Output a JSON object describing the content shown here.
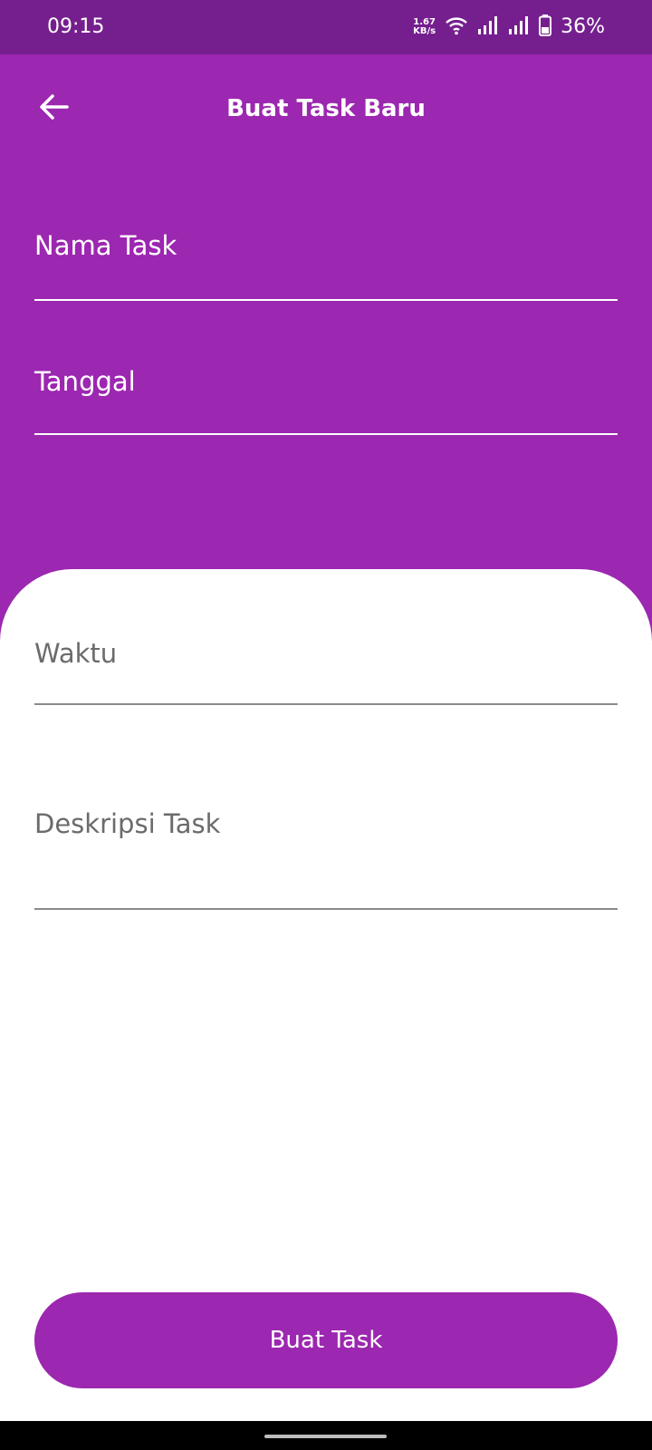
{
  "status_bar": {
    "time": "09:15",
    "net_speed_value": "1.67",
    "net_speed_unit": "KB/s",
    "battery_percent": "36%",
    "icons": [
      "wifi-icon",
      "signal-icon",
      "signal-icon",
      "battery-icon"
    ]
  },
  "header": {
    "title": "Buat Task Baru",
    "back_icon": "arrow-left-icon"
  },
  "form": {
    "nama_task_placeholder": "Nama Task",
    "tanggal_placeholder": "Tanggal",
    "waktu_placeholder": "Waktu",
    "deskripsi_placeholder": "Deskripsi Task"
  },
  "actions": {
    "submit_label": "Buat Task"
  },
  "colors": {
    "primary": "#9c27b0",
    "status_bar": "#751f8e",
    "sheet": "#ffffff"
  }
}
